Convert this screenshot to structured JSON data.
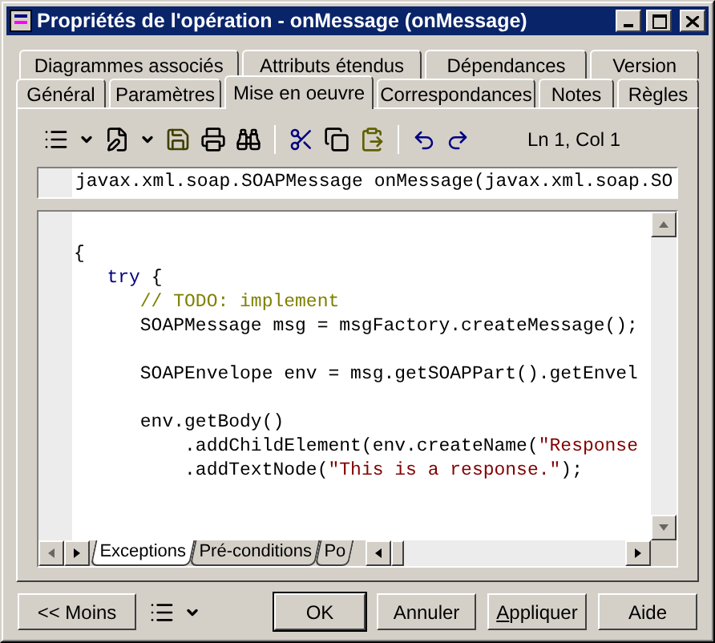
{
  "window": {
    "title": "Propriétés de l'opération - onMessage (onMessage)"
  },
  "tabs_back": [
    {
      "label": "Diagrammes associés",
      "selected": false
    },
    {
      "label": "Attributs étendus",
      "selected": false
    },
    {
      "label": "Dépendances",
      "selected": false
    },
    {
      "label": "Version",
      "selected": false
    }
  ],
  "tabs_front": [
    {
      "label": "Général",
      "selected": false
    },
    {
      "label": "Paramètres",
      "selected": false
    },
    {
      "label": "Mise en oeuvre",
      "selected": true
    },
    {
      "label": "Correspondances",
      "selected": false
    },
    {
      "label": "Notes",
      "selected": false
    },
    {
      "label": "Règles",
      "selected": false
    }
  ],
  "toolbar": {
    "position": "Ln 1, Col 1"
  },
  "signature": {
    "value": "javax.xml.soap.SOAPMessage onMessage(javax.xml.soap.SO"
  },
  "code": {
    "lines": [
      {
        "kind": "code",
        "tokens": [
          {
            "text": "{",
            "kind": "plain"
          }
        ]
      },
      {
        "kind": "code",
        "tokens": [
          {
            "text": "   try",
            "kind": "keyword"
          },
          {
            "text": " {",
            "kind": "plain"
          }
        ]
      },
      {
        "kind": "code",
        "tokens": [
          {
            "text": "      // TODO: implement",
            "kind": "comment"
          }
        ]
      },
      {
        "kind": "code",
        "tokens": [
          {
            "text": "      SOAPMessage msg = msgFactory.createMessage();",
            "kind": "plain"
          }
        ]
      },
      {
        "kind": "blank"
      },
      {
        "kind": "code",
        "tokens": [
          {
            "text": "      SOAPEnvelope env = msg.getSOAPPart().getEnvel",
            "kind": "plain"
          }
        ]
      },
      {
        "kind": "blank"
      },
      {
        "kind": "code",
        "tokens": [
          {
            "text": "      env.getBody()",
            "kind": "plain"
          }
        ]
      },
      {
        "kind": "code",
        "tokens": [
          {
            "text": "          .addChildElement(env.createName(",
            "kind": "plain"
          },
          {
            "text": "\"Response",
            "kind": "string"
          }
        ]
      },
      {
        "kind": "code",
        "tokens": [
          {
            "text": "          .addTextNode(",
            "kind": "plain"
          },
          {
            "text": "\"This is a response.\"",
            "kind": "string"
          },
          {
            "text": ");",
            "kind": "plain"
          }
        ]
      }
    ]
  },
  "sheet_tabs": [
    {
      "label": "Exceptions",
      "selected": true
    },
    {
      "label": "Pré-conditions",
      "selected": false
    },
    {
      "label": "Po",
      "selected": false
    }
  ],
  "buttons": [
    {
      "label": "<< Moins",
      "kind": "less",
      "default": false,
      "underline_first": false
    },
    {
      "label": "OK",
      "kind": "ok",
      "default": true,
      "underline_first": false
    },
    {
      "label": "Annuler",
      "kind": "cancel",
      "default": false,
      "underline_first": false
    },
    {
      "label": "Appliquer",
      "kind": "apply",
      "default": false,
      "underline_first": true
    },
    {
      "label": "Aide",
      "kind": "help",
      "default": false,
      "underline_first": false
    }
  ]
}
